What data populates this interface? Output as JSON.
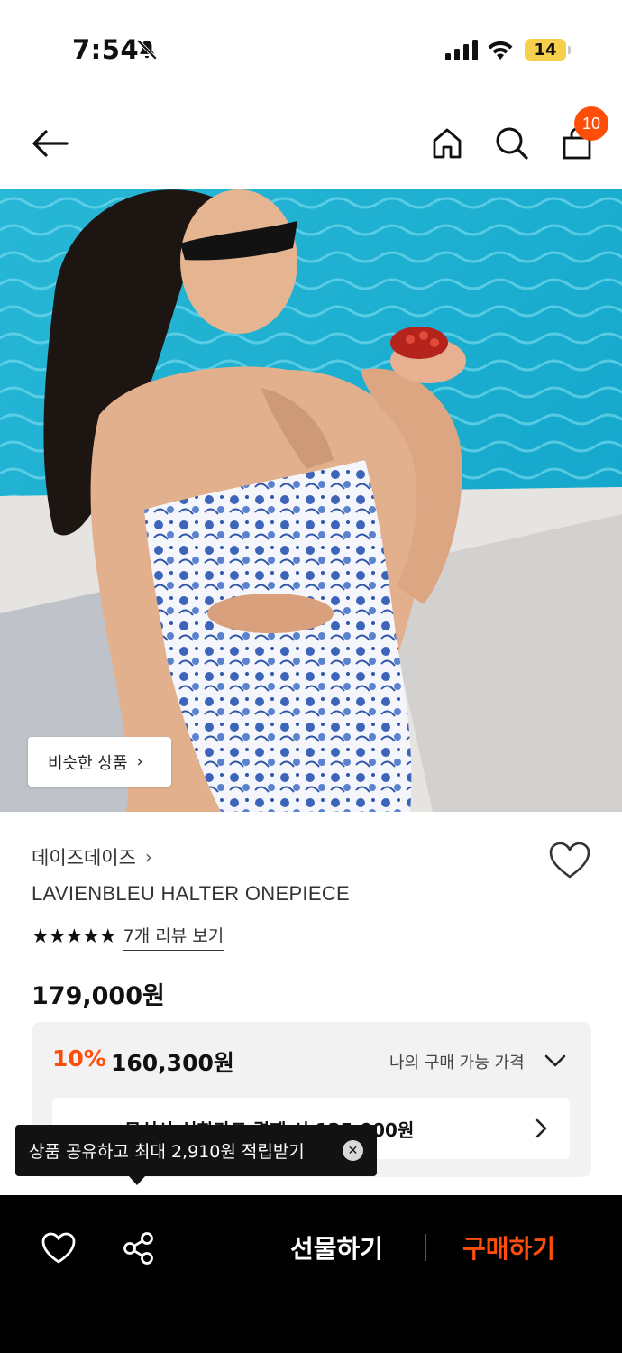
{
  "status_bar": {
    "time": "7:54",
    "battery": "14"
  },
  "header": {
    "cart_count": "10"
  },
  "image": {
    "similar_label": "비슷한 상품",
    "chevron": "›"
  },
  "product": {
    "brand": "데이즈데이즈",
    "brand_chevron": "›",
    "name": "LAVIENBLEU HALTER ONEPIECE",
    "stars": "★★★★★",
    "rating": 5,
    "review_link": "7개 리뷰 보기",
    "price": "179,000원"
  },
  "discount": {
    "rate": "10%",
    "price": "160,300원",
    "my_price_label": "나의 구매 가능 가격",
    "card_text": "무신사 신한카드 결제 시 125,000원"
  },
  "tooltip": {
    "text": "상품 공유하고 최대 2,910원 적립받기",
    "close": "✕"
  },
  "bottom_bar": {
    "gift_label": "선물하기",
    "buy_label": "구매하기"
  },
  "colors": {
    "accent": "#ff4d0a",
    "bottom_bar": "#000000",
    "discount_box": "#f2f2f2",
    "battery": "#f6d04d"
  },
  "icons": [
    "back-arrow-icon",
    "home-icon",
    "search-icon",
    "shopping-bag-icon",
    "heart-icon",
    "share-icon",
    "chevron-down-icon",
    "chevron-right-icon",
    "close-icon",
    "bell-off-icon",
    "signal-icon",
    "wifi-icon"
  ]
}
